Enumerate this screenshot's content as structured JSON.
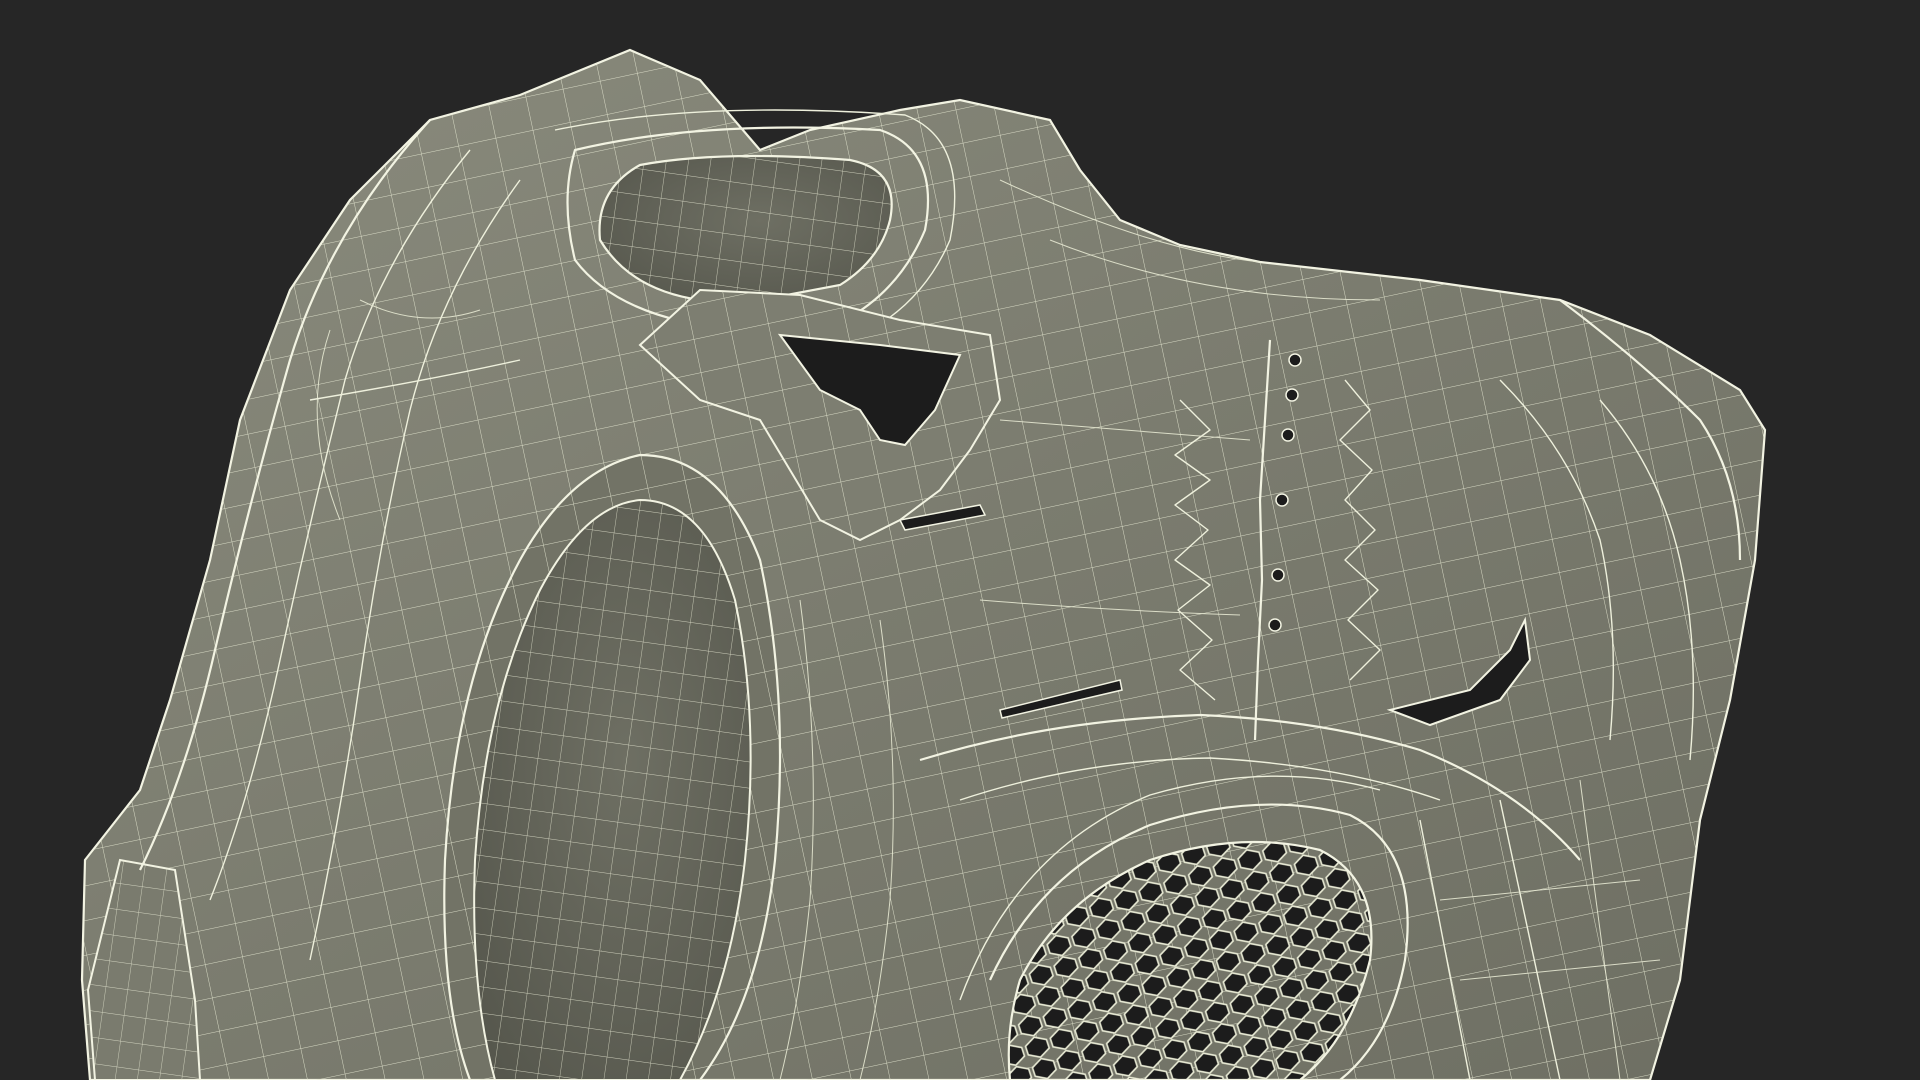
{
  "scene": {
    "subject": "3d-wireframe-mesh",
    "colors": {
      "background": "#262626",
      "surface": "#7a7b6e",
      "surface_dark": "#5f6056",
      "surface_light": "#8b8c7e",
      "wire": "#eef0dc",
      "hole": "#1c1c1c"
    }
  }
}
